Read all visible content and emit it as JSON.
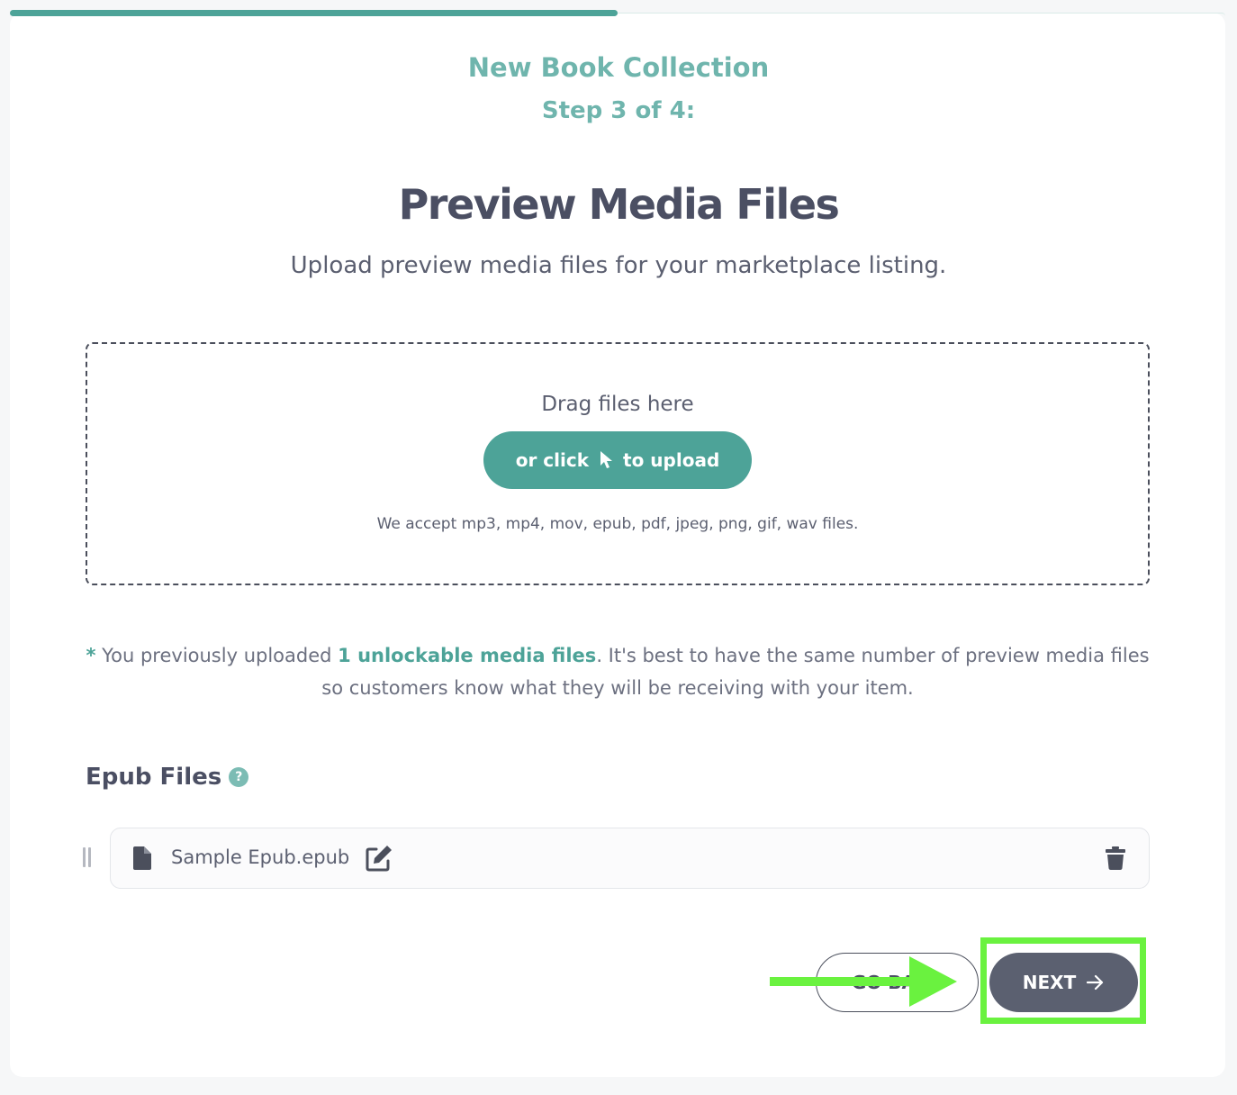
{
  "colors": {
    "accent": "#4da398",
    "accent_light": "#6fb5ad",
    "dark_button": "#5b6070",
    "annotation_green": "#6af23f"
  },
  "wizard": {
    "progress_fraction": 0.5,
    "collection_title": "New Book Collection",
    "step_label": "Step 3 of 4:"
  },
  "header": {
    "title": "Preview Media Files",
    "subtitle": "Upload preview media files for your marketplace listing."
  },
  "dropzone": {
    "drag_text": "Drag files here",
    "upload_before": "or click",
    "upload_cursor_icon": "pointer-cursor-icon",
    "upload_after": "to upload",
    "accept_text": "We accept mp3, mp4, mov, epub, pdf, jpeg, png, gif, wav files."
  },
  "notice": {
    "star": "*",
    "before": " You previously uploaded ",
    "highlight": "1 unlockable media files",
    "after": ". It's best to have the same number of preview media files so customers know what they will be receiving with your item."
  },
  "epub_section": {
    "title": "Epub Files",
    "help": "?",
    "files": [
      {
        "name": "Sample Epub.epub",
        "icon": "file-icon"
      }
    ]
  },
  "actions": {
    "back_label": "GO BACK",
    "next_label": "NEXT"
  }
}
